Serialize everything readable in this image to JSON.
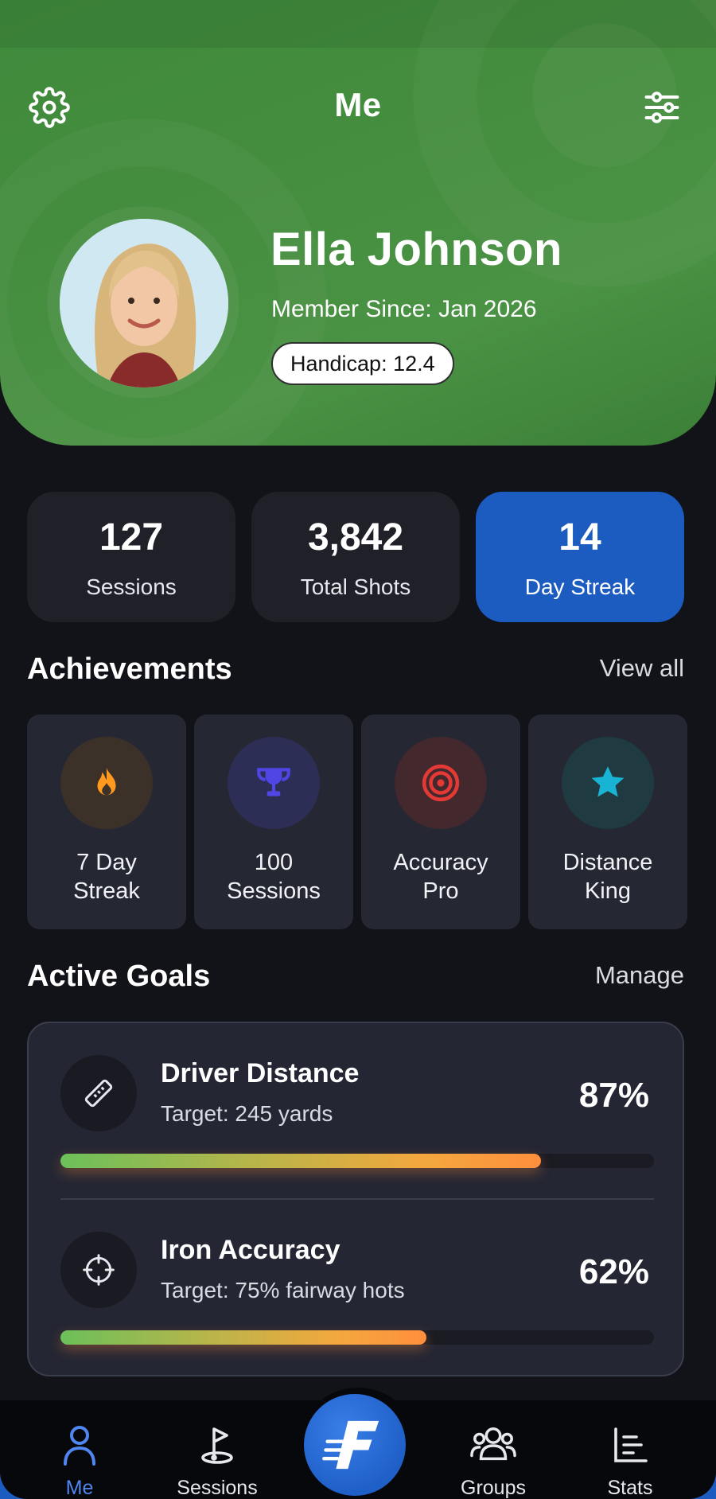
{
  "header": {
    "title": "Me",
    "settings_icon": "gear-icon",
    "filter_icon": "sliders-icon",
    "profile": {
      "name": "Ella Johnson",
      "member_since": "Member Since: Jan 2026",
      "handicap": "Handicap: 12.4"
    }
  },
  "stats": [
    {
      "value": "127",
      "label": "Sessions",
      "active": false
    },
    {
      "value": "3,842",
      "label": "Total Shots",
      "active": false
    },
    {
      "value": "14",
      "label": "Day Streak",
      "active": true
    }
  ],
  "achievements": {
    "title": "Achievements",
    "link": "View all",
    "items": [
      {
        "label_line1": "7 Day",
        "label_line2": "Streak",
        "icon": "flame-icon",
        "color": "#ff9a1f",
        "bg": "#3b3128"
      },
      {
        "label_line1": "100",
        "label_line2": "Sessions",
        "icon": "trophy-icon",
        "color": "#4f46e5",
        "bg": "#2c2e55"
      },
      {
        "label_line1": "Accuracy",
        "label_line2": "Pro",
        "icon": "target-icon",
        "color": "#e53935",
        "bg": "#43282d"
      },
      {
        "label_line1": "Distance",
        "label_line2": "King",
        "icon": "star-icon",
        "color": "#19b3d4",
        "bg": "#1f3a40"
      }
    ]
  },
  "goals": {
    "title": "Active Goals",
    "link": "Manage",
    "items": [
      {
        "title": "Driver Distance",
        "target": "Target: 245 yards",
        "percent_label": "87%",
        "progress": 0.81,
        "icon": "ruler-icon"
      },
      {
        "title": "Iron Accuracy",
        "target": "Target: 75% fairway hots",
        "percent_label": "62%",
        "progress": 0.617,
        "icon": "crosshair-icon"
      }
    ]
  },
  "nav": {
    "items": [
      {
        "label": "Me",
        "icon": "person-icon",
        "active": true
      },
      {
        "label": "Sessions",
        "icon": "golf-flag-icon",
        "active": false
      },
      {
        "label": "Groups",
        "icon": "group-icon",
        "active": false
      },
      {
        "label": "Stats",
        "icon": "bar-chart-icon",
        "active": false
      }
    ],
    "center_button_icon": "app-logo-icon"
  },
  "colors": {
    "accent": "#1c5bbf",
    "header_green": "#458d3f",
    "background": "#121318",
    "nav_active": "#4f86f0"
  }
}
